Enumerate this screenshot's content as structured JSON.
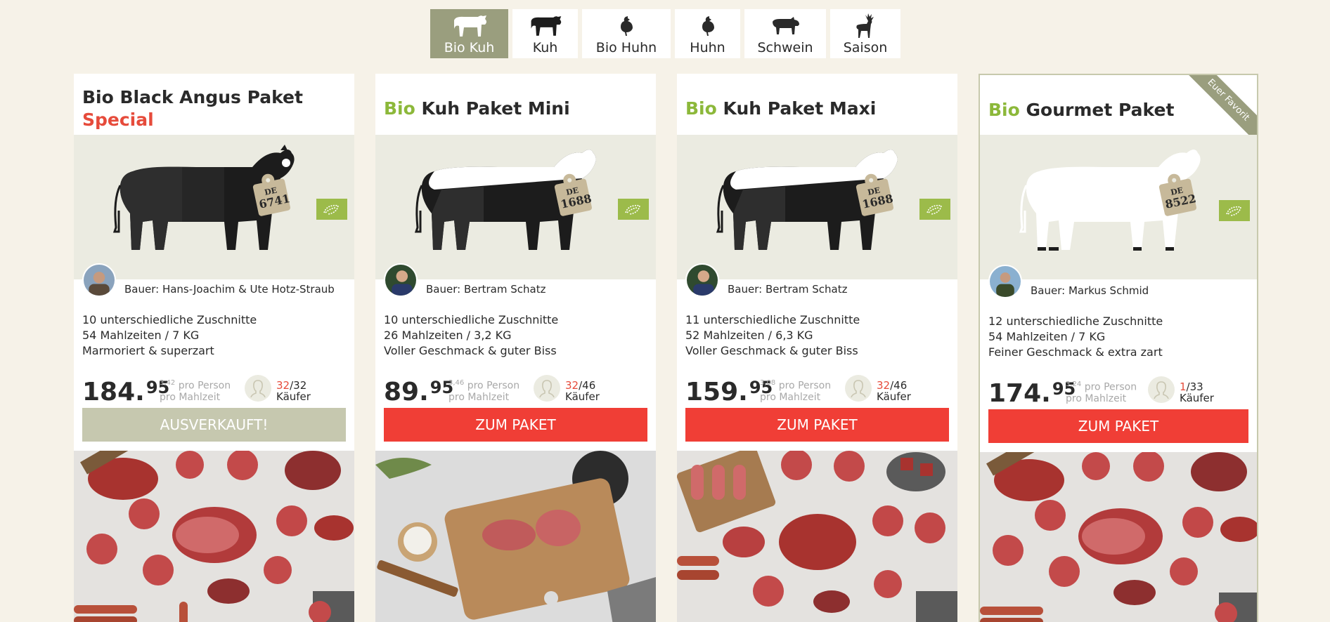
{
  "tabs": [
    {
      "label": "Bio Kuh",
      "icon": "cow-icon",
      "active": true
    },
    {
      "label": "Kuh",
      "icon": "cow-icon",
      "active": false
    },
    {
      "label": "Bio Huhn",
      "icon": "chicken-icon",
      "active": false
    },
    {
      "label": "Huhn",
      "icon": "chicken-icon",
      "active": false
    },
    {
      "label": "Schwein",
      "icon": "pig-icon",
      "active": false
    },
    {
      "label": "Saison",
      "icon": "deer-icon",
      "active": false
    }
  ],
  "cards": [
    {
      "title_bio": "",
      "title": "Bio Black Angus Paket",
      "title_special": "Special",
      "ear_tag_country": "DE",
      "ear_tag_number": "6741",
      "farmer": "Bauer: Hans-Joachim & Ute Hotz-Straub",
      "features": [
        "10 unterschiedliche Zuschnitte",
        "54 Mahlzeiten / 7 KG",
        "Marmoriert & superzart"
      ],
      "price_main": "184.",
      "price_cents": "95",
      "per_person_value": "3,42",
      "per_person_label1": "pro Person",
      "per_person_label2": "pro Mahlzeit",
      "buyers_current": "32",
      "buyers_total": "/32",
      "buyers_label": "Käufer",
      "cta": "AUSVERKAUFT!",
      "sold_out": true,
      "favorite": false
    },
    {
      "title_bio": "Bio",
      "title": "Kuh Paket Mini",
      "title_special": "",
      "ear_tag_country": "DE",
      "ear_tag_number": "1688",
      "farmer": "Bauer: Bertram Schatz",
      "features": [
        "10 unterschiedliche Zuschnitte",
        "26 Mahlzeiten / 3,2 KG",
        "Voller Geschmack & guter Biss"
      ],
      "price_main": "89.",
      "price_cents": "95",
      "per_person_value": "3,46",
      "per_person_label1": "pro Person",
      "per_person_label2": "pro Mahlzeit",
      "buyers_current": "32",
      "buyers_total": "/46",
      "buyers_label": "Käufer",
      "cta": "ZUM PAKET",
      "sold_out": false,
      "favorite": false
    },
    {
      "title_bio": "Bio",
      "title": "Kuh Paket Maxi",
      "title_special": "",
      "ear_tag_country": "DE",
      "ear_tag_number": "1688",
      "farmer": "Bauer: Bertram Schatz",
      "features": [
        "11 unterschiedliche Zuschnitte",
        "52 Mahlzeiten / 6,3 KG",
        "Voller Geschmack & guter Biss"
      ],
      "price_main": "159.",
      "price_cents": "95",
      "per_person_value": "3,08",
      "per_person_label1": "pro Person",
      "per_person_label2": "pro Mahlzeit",
      "buyers_current": "32",
      "buyers_total": "/46",
      "buyers_label": "Käufer",
      "cta": "ZUM PAKET",
      "sold_out": false,
      "favorite": false
    },
    {
      "title_bio": "Bio",
      "title": "Gourmet Paket",
      "title_special": "",
      "ear_tag_country": "DE",
      "ear_tag_number": "8522",
      "farmer": "Bauer: Markus Schmid",
      "features": [
        "12 unterschiedliche Zuschnitte",
        "54 Mahlzeiten / 7 KG",
        "Feiner Geschmack & extra zart"
      ],
      "price_main": "174.",
      "price_cents": "95",
      "per_person_value": "3,24",
      "per_person_label1": "pro Person",
      "per_person_label2": "pro Mahlzeit",
      "buyers_current": "1",
      "buyers_total": "/33",
      "buyers_label": "Käufer",
      "cta": "ZUM PAKET",
      "sold_out": false,
      "favorite": true,
      "ribbon": "Euer Favorit"
    }
  ],
  "colors": {
    "background": "#f6f2e8",
    "bio_green": "#8cb83a",
    "accent_red": "#f03e36",
    "special_red": "#e64b3b",
    "sold_out": "#c6c8af",
    "tab_active": "#9a9e7e"
  }
}
